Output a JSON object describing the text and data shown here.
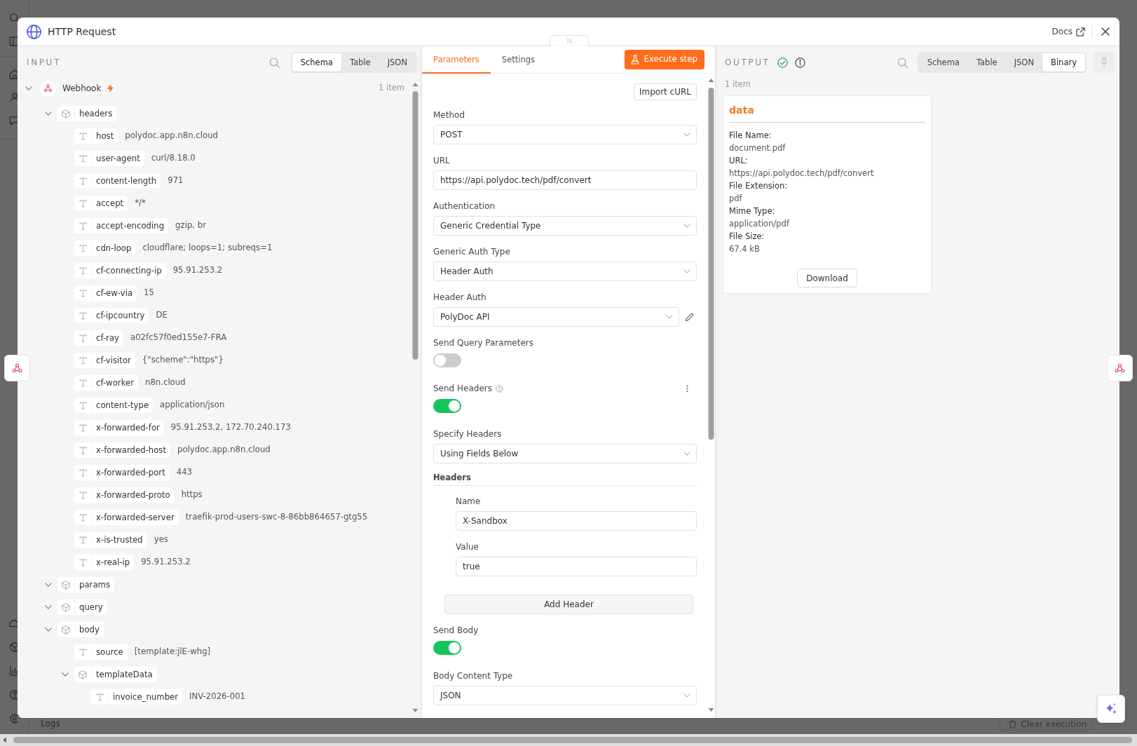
{
  "window": {
    "title": "HTTP Request",
    "docs_link": "Docs"
  },
  "input_panel": {
    "title": "INPUT",
    "view_tabs": [
      {
        "label": "Schema",
        "selected": true
      },
      {
        "label": "Table",
        "selected": false
      },
      {
        "label": "JSON",
        "selected": false
      }
    ],
    "source": {
      "name": "Webhook",
      "trigger": true,
      "expanded": true,
      "item_count": "1 item",
      "children": [
        {
          "key": "headers",
          "kind": "object",
          "expanded": true,
          "children": [
            {
              "key": "host",
              "kind": "string",
              "value": "polydoc.app.n8n.cloud"
            },
            {
              "key": "user-agent",
              "kind": "string",
              "value": "curl/8.18.0"
            },
            {
              "key": "content-length",
              "kind": "string",
              "value": "971"
            },
            {
              "key": "accept",
              "kind": "string",
              "value": "*/*"
            },
            {
              "key": "accept-encoding",
              "kind": "string",
              "value": "gzip, br"
            },
            {
              "key": "cdn-loop",
              "kind": "string",
              "value": "cloudflare; loops=1; subreqs=1"
            },
            {
              "key": "cf-connecting-ip",
              "kind": "string",
              "value": "95.91.253.2"
            },
            {
              "key": "cf-ew-via",
              "kind": "string",
              "value": "15"
            },
            {
              "key": "cf-ipcountry",
              "kind": "string",
              "value": "DE"
            },
            {
              "key": "cf-ray",
              "kind": "string",
              "value": "a02fc57f0ed155e7-FRA"
            },
            {
              "key": "cf-visitor",
              "kind": "string",
              "value": "{\"scheme\":\"https\"}"
            },
            {
              "key": "cf-worker",
              "kind": "string",
              "value": "n8n.cloud"
            },
            {
              "key": "content-type",
              "kind": "string",
              "value": "application/json"
            },
            {
              "key": "x-forwarded-for",
              "kind": "string",
              "value": "95.91.253.2, 172.70.240.173"
            },
            {
              "key": "x-forwarded-host",
              "kind": "string",
              "value": "polydoc.app.n8n.cloud"
            },
            {
              "key": "x-forwarded-port",
              "kind": "string",
              "value": "443"
            },
            {
              "key": "x-forwarded-proto",
              "kind": "string",
              "value": "https"
            },
            {
              "key": "x-forwarded-server",
              "kind": "string",
              "value": "traefik-prod-users-swc-8-86bb864657-gtg55"
            },
            {
              "key": "x-is-trusted",
              "kind": "string",
              "value": "yes"
            },
            {
              "key": "x-real-ip",
              "kind": "string",
              "value": "95.91.253.2"
            }
          ]
        },
        {
          "key": "params",
          "kind": "object",
          "expanded": true
        },
        {
          "key": "query",
          "kind": "object",
          "expanded": true
        },
        {
          "key": "body",
          "kind": "object",
          "expanded": true,
          "children": [
            {
              "key": "source",
              "kind": "string",
              "value": "[template:jlE-whg]"
            },
            {
              "key": "templateData",
              "kind": "object",
              "expanded": true,
              "children": [
                {
                  "key": "invoice_number",
                  "kind": "string",
                  "value": "INV-2026-001"
                }
              ]
            }
          ]
        }
      ]
    }
  },
  "parameters_panel": {
    "tabs": [
      {
        "label": "Parameters",
        "selected": true
      },
      {
        "label": "Settings",
        "selected": false
      }
    ],
    "execute_button": "Execute step",
    "import_button": "Import cURL",
    "fields": [
      {
        "kind": "select",
        "label": "Method",
        "value": "POST"
      },
      {
        "kind": "input",
        "label": "URL",
        "value": "https://api.polydoc.tech/pdf/convert"
      },
      {
        "kind": "select",
        "label": "Authentication",
        "value": "Generic Credential Type"
      },
      {
        "kind": "select",
        "label": "Generic Auth Type",
        "value": "Header Auth"
      },
      {
        "kind": "credential",
        "label": "Header Auth",
        "value": "PolyDoc API"
      },
      {
        "kind": "toggle",
        "label": "Send Query Parameters",
        "on": false
      },
      {
        "kind": "toggle",
        "label": "Send Headers",
        "on": true,
        "help": true,
        "menu": true
      },
      {
        "kind": "select",
        "label": "Specify Headers",
        "value": "Using Fields Below"
      },
      {
        "kind": "collection",
        "label": "Headers",
        "entries": [
          {
            "fields": [
              {
                "label": "Name",
                "value": "X-Sandbox"
              },
              {
                "label": "Value",
                "value": "true"
              }
            ]
          }
        ],
        "add_button": "Add Header"
      },
      {
        "kind": "toggle",
        "label": "Send Body",
        "on": true
      },
      {
        "kind": "select",
        "label": "Body Content Type",
        "value": "JSON"
      }
    ]
  },
  "output_panel": {
    "title": "OUTPUT",
    "succeeded": true,
    "view_tabs": [
      {
        "label": "Schema",
        "selected": false
      },
      {
        "label": "Table",
        "selected": false
      },
      {
        "label": "JSON",
        "selected": false
      },
      {
        "label": "Binary",
        "selected": true
      }
    ],
    "item_count": "1 item",
    "binary": {
      "title": "data",
      "properties": [
        {
          "label": "File Name:",
          "value": "document.pdf"
        },
        {
          "label": "URL:",
          "value": "https://api.polydoc.tech/pdf/convert"
        },
        {
          "label": "File Extension:",
          "value": "pdf"
        },
        {
          "label": "Mime Type:",
          "value": "application/pdf"
        },
        {
          "label": "File Size:",
          "value": "67.4 kB"
        }
      ],
      "download_button": "Download"
    }
  },
  "logs_bar": {
    "title": "Logs",
    "clear_button": "Clear execution"
  }
}
